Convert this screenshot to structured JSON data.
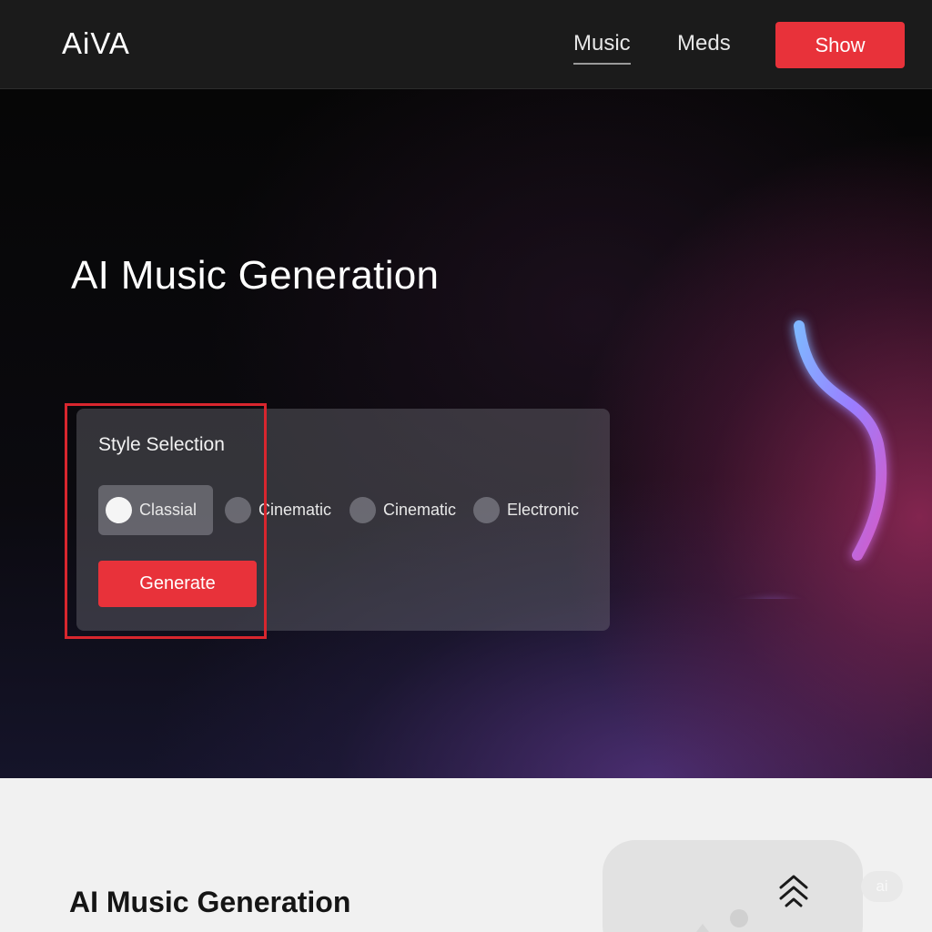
{
  "header": {
    "logo": "AiVA",
    "nav": [
      {
        "label": "Music",
        "active": true
      },
      {
        "label": "Meds",
        "active": false
      }
    ],
    "show_button": "Show"
  },
  "hero": {
    "title": "AI Music Generation",
    "icon": "music-note-icon",
    "style_panel": {
      "title": "Style Selection",
      "options": [
        {
          "label": "Classial",
          "selected": true
        },
        {
          "label": "Cinematic",
          "selected": false
        },
        {
          "label": "Cinematic",
          "selected": false
        },
        {
          "label": "Electronic",
          "selected": false
        }
      ],
      "generate_button": "Generate"
    }
  },
  "lower": {
    "title": "AI Music Generation",
    "badge": "ai",
    "icons": [
      "cloud-upload-icon",
      "image-placeholder-icon"
    ]
  },
  "colors": {
    "accent": "#e8323a",
    "header_bg": "#1b1b1b",
    "highlight": "#d8262e"
  }
}
